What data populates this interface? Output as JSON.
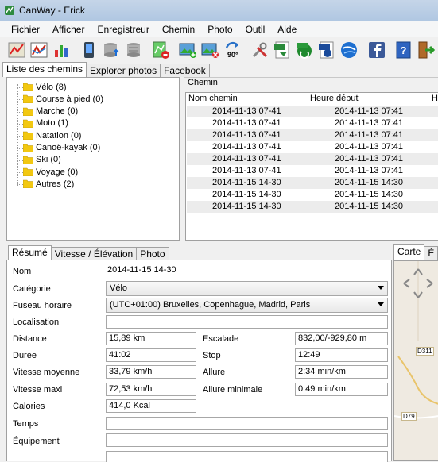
{
  "window": {
    "title": "CanWay - Erick"
  },
  "menu": [
    "Fichier",
    "Afficher",
    "Enregistreur",
    "Chemin",
    "Photo",
    "Outil",
    "Aide"
  ],
  "toolbar": {
    "icons": [
      "map-chart-icon",
      "line-chart-icon",
      "bar-chart-icon",
      "device-icon",
      "database-upload-icon",
      "database-icon",
      "map-delete-icon",
      "image-add-icon",
      "image-remove-icon",
      "rotate-icon",
      "tools-icon",
      "export-gpx-icon",
      "export-kml-icon",
      "export-kmz-icon",
      "google-earth-icon",
      "facebook-icon",
      "help-icon",
      "exit-icon"
    ],
    "rotate_label": "90°"
  },
  "left_tabs": [
    "Liste des chemins",
    "Explorer photos",
    "Facebook"
  ],
  "tree": [
    {
      "label": "Vélo (8)"
    },
    {
      "label": "Course à pied (0)"
    },
    {
      "label": "Marche (0)"
    },
    {
      "label": "Moto (1)"
    },
    {
      "label": "Natation (0)"
    },
    {
      "label": "Canoë-kayak (0)"
    },
    {
      "label": "Ski (0)"
    },
    {
      "label": "Voyage (0)"
    },
    {
      "label": "Autres (2)"
    }
  ],
  "chemin": {
    "legend": "Chemin",
    "columns": [
      "Nom chemin",
      "Heure début",
      "H"
    ],
    "rows": [
      {
        "name": "2014-11-13 07-41",
        "start": "2014-11-13 07:41"
      },
      {
        "name": "2014-11-13 07-41",
        "start": "2014-11-13 07:41"
      },
      {
        "name": "2014-11-13 07-41",
        "start": "2014-11-13 07:41"
      },
      {
        "name": "2014-11-13 07-41",
        "start": "2014-11-13 07:41"
      },
      {
        "name": "2014-11-13 07-41",
        "start": "2014-11-13 07:41"
      },
      {
        "name": "2014-11-13 07-41",
        "start": "2014-11-13 07:41"
      },
      {
        "name": "2014-11-15 14-30",
        "start": "2014-11-15 14:30"
      },
      {
        "name": "2014-11-15 14-30",
        "start": "2014-11-15 14:30"
      },
      {
        "name": "2014-11-15 14-30",
        "start": "2014-11-15 14:30"
      }
    ]
  },
  "detail_tabs": [
    "Résumé",
    "Vitesse / Élévation",
    "Photo"
  ],
  "summary": {
    "nom_label": "Nom",
    "nom": "2014-11-15 14-30",
    "categorie_label": "Catégorie",
    "categorie": "Vélo",
    "fuseau_label": "Fuseau horaire",
    "fuseau": "(UTC+01:00) Bruxelles, Copenhague, Madrid, Paris",
    "localisation_label": "Localisation",
    "localisation": "",
    "distance_label": "Distance",
    "distance": "15,89 km",
    "escalade_label": "Escalade",
    "escalade": "832,00/-929,80 m",
    "duree_label": "Durée",
    "duree": "41:02",
    "stop_label": "Stop",
    "stop": "12:49",
    "vitesse_moy_label": "Vitesse moyenne",
    "vitesse_moy": "33,79 km/h",
    "allure_label": "Allure",
    "allure": "2:34 min/km",
    "vitesse_max_label": "Vitesse maxi",
    "vitesse_max": "72,53 km/h",
    "allure_min_label": "Allure minimale",
    "allure_min": "0:49 min/km",
    "calories_label": "Calories",
    "calories": "414,0 Kcal",
    "temps_label": "Temps",
    "temps": "",
    "equipement_label": "Équipement",
    "equipement": ""
  },
  "map_tabs": [
    "Carte",
    "É"
  ],
  "map": {
    "road1": "D311",
    "road2": "D79"
  },
  "colors": {
    "titlebar": "#b7cbe3",
    "accent_blue": "#3b5998",
    "folder": "#f2c811"
  }
}
